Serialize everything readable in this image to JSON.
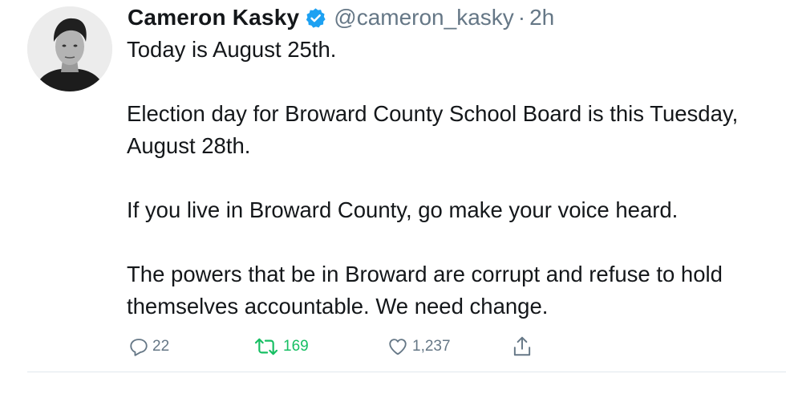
{
  "tweet": {
    "author": {
      "display_name": "Cameron Kasky",
      "verified": true,
      "handle": "@cameron_kasky",
      "separator": "·",
      "time": "2h"
    },
    "paragraphs": [
      "Today is August 25th.",
      "Election day for Broward County School Board is this Tuesday, August 28th.",
      "If you live in Broward County, go make your voice heard.",
      "The powers that be in Broward are corrupt and refuse to hold themselves accountable. We need change."
    ],
    "actions": {
      "replies": "22",
      "retweets": "169",
      "likes": "1,237",
      "reply_icon": "reply-icon",
      "retweet_icon": "retweet-icon",
      "like_icon": "heart-icon",
      "share_icon": "share-icon"
    }
  },
  "colors": {
    "text": "#14171a",
    "secondary": "#657786",
    "verified_blue": "#1da1f2",
    "retweet_green": "#17bf63",
    "divider": "#e1e8ed"
  }
}
